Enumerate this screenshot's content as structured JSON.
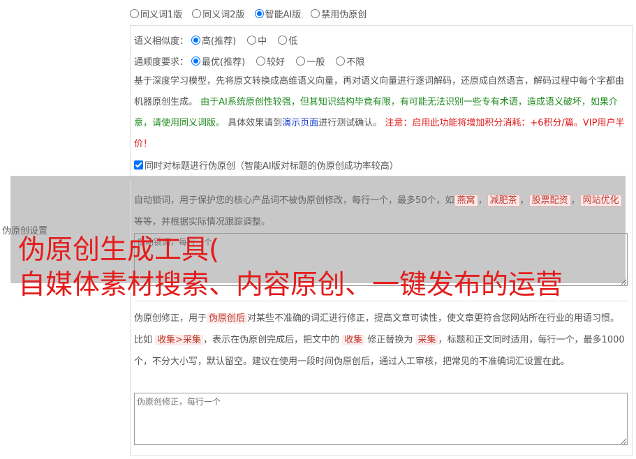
{
  "version_options": [
    {
      "label": "同义词1版",
      "selected": false
    },
    {
      "label": "同义词2版",
      "selected": false
    },
    {
      "label": "智能AI版",
      "selected": true
    },
    {
      "label": "禁用伪原创",
      "selected": false
    }
  ],
  "similarity": {
    "label": "语义相似度：",
    "options": [
      {
        "label": "高(推荐)",
        "selected": true
      },
      {
        "label": "中",
        "selected": false
      },
      {
        "label": "低",
        "selected": false
      }
    ]
  },
  "fluency": {
    "label": "通顺度要求：",
    "options": [
      {
        "label": "最优(推荐)",
        "selected": true
      },
      {
        "label": "较好",
        "selected": false
      },
      {
        "label": "一般",
        "selected": false
      },
      {
        "label": "不限",
        "selected": false
      }
    ]
  },
  "description": {
    "part1": "基于深度学习模型，先将原文转换成高维语义向量，再对语义向量进行逐词解码，还原成自然语言，解码过程中每个字都由机器原创生成。",
    "green": "由于AI系统原创性较强，但其知识结构毕竟有限，有可能无法识别一些专有术语，造成语义破坏，如果介意，请使用同义词版。",
    "part2": "具体效果请到",
    "link": "演示页面",
    "part3": "进行测试确认。",
    "red": "注意：启用此功能将增加积分消耗：+6积分/篇。VIP用户半价！"
  },
  "title_checkbox": {
    "label": "同时对标题进行伪原创（智能AI版对标题的伪原创成功率较高）",
    "checked": true
  },
  "side_label": "伪原创设置",
  "lock_words": {
    "text_a": "自动锁词，用于保护您的核心产品词不被伪原创修改，每行一个，最多50个，如",
    "examples": [
      "燕窝",
      "减肥茶",
      "股票配资",
      "网站优化"
    ],
    "text_b": "等等，并根据实际情况跟踪调整。",
    "placeholder": "自动锁词，每行一个"
  },
  "overlay": {
    "line1": "伪原创生成工具(",
    "line2": "自媒体素材搜索、内容原创、一键发布的运营"
  },
  "correction": {
    "t1": "伪原创修正，用于",
    "tag1": "伪原创后",
    "t2": "对某些不准确的词汇进行修正，提高文章可读性，使文章更符合您网站所在行业的用语习惯。比如",
    "tag2": "收集>采集",
    "t3": "，表示在伪原创完成后，把文中的",
    "tag3": "收集",
    "t4": "修正替换为",
    "tag4": "采集",
    "t5": "，标题和正文同时适用，每行一个，最多1000个，不分大小写，默认留空。建议在使用一段时间伪原创后，通过人工审核，把常见的不准确词汇设置在此。",
    "placeholder": "伪原创修正，每行一个"
  }
}
